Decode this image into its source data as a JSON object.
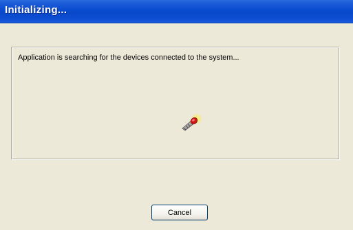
{
  "window": {
    "title": "Initializing..."
  },
  "status": {
    "message": "Application is searching for the devices connected to the system..."
  },
  "icons": {
    "device": "device-probe-icon"
  },
  "buttons": {
    "cancel_label": "Cancel"
  },
  "colors": {
    "titlebar": "#0B4BD0",
    "window_background": "#ECE9D8",
    "button_border": "#003C74"
  }
}
